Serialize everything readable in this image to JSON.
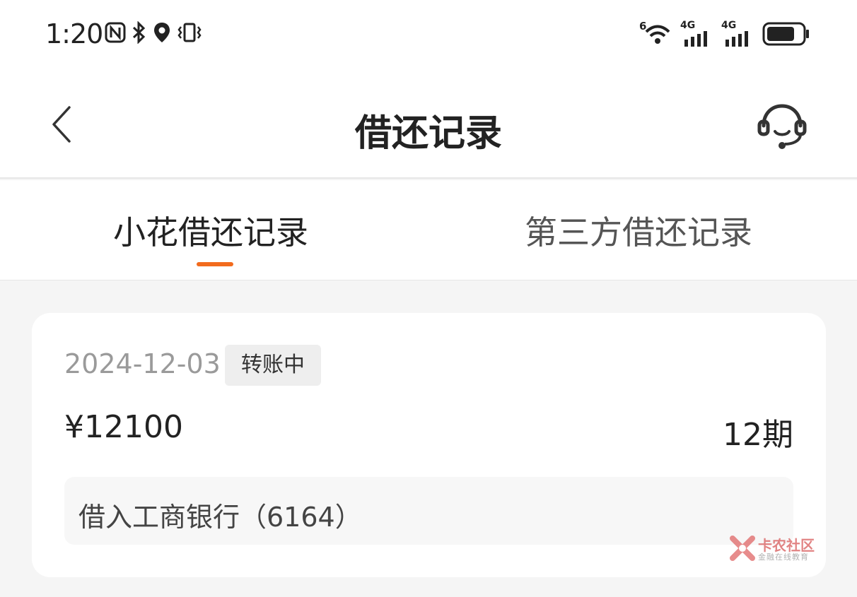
{
  "status_bar": {
    "time": "1:20",
    "wifi_label": "6",
    "signal_1_label": "4G",
    "signal_2_label": "4G",
    "icons_left": [
      "nfc-icon",
      "bluetooth-icon",
      "location-icon",
      "vibrate-icon"
    ],
    "icons_right": [
      "wifi-icon",
      "signal-icon",
      "signal-icon",
      "battery-icon"
    ]
  },
  "header": {
    "title": "借还记录",
    "back_icon": "chevron-left-icon",
    "support_icon": "headset-icon"
  },
  "tabs": [
    {
      "label": "小花借还记录",
      "active": true
    },
    {
      "label": "第三方借还记录",
      "active": false
    }
  ],
  "accent_color": "#f26b1d",
  "record": {
    "date": "2024-12-03",
    "status": "转账中",
    "amount": "¥12100",
    "periods": "12期",
    "bank": "借入工商银行（6164）"
  },
  "watermark": {
    "title": "卡农社区",
    "subtitle": "金融在线教育"
  }
}
